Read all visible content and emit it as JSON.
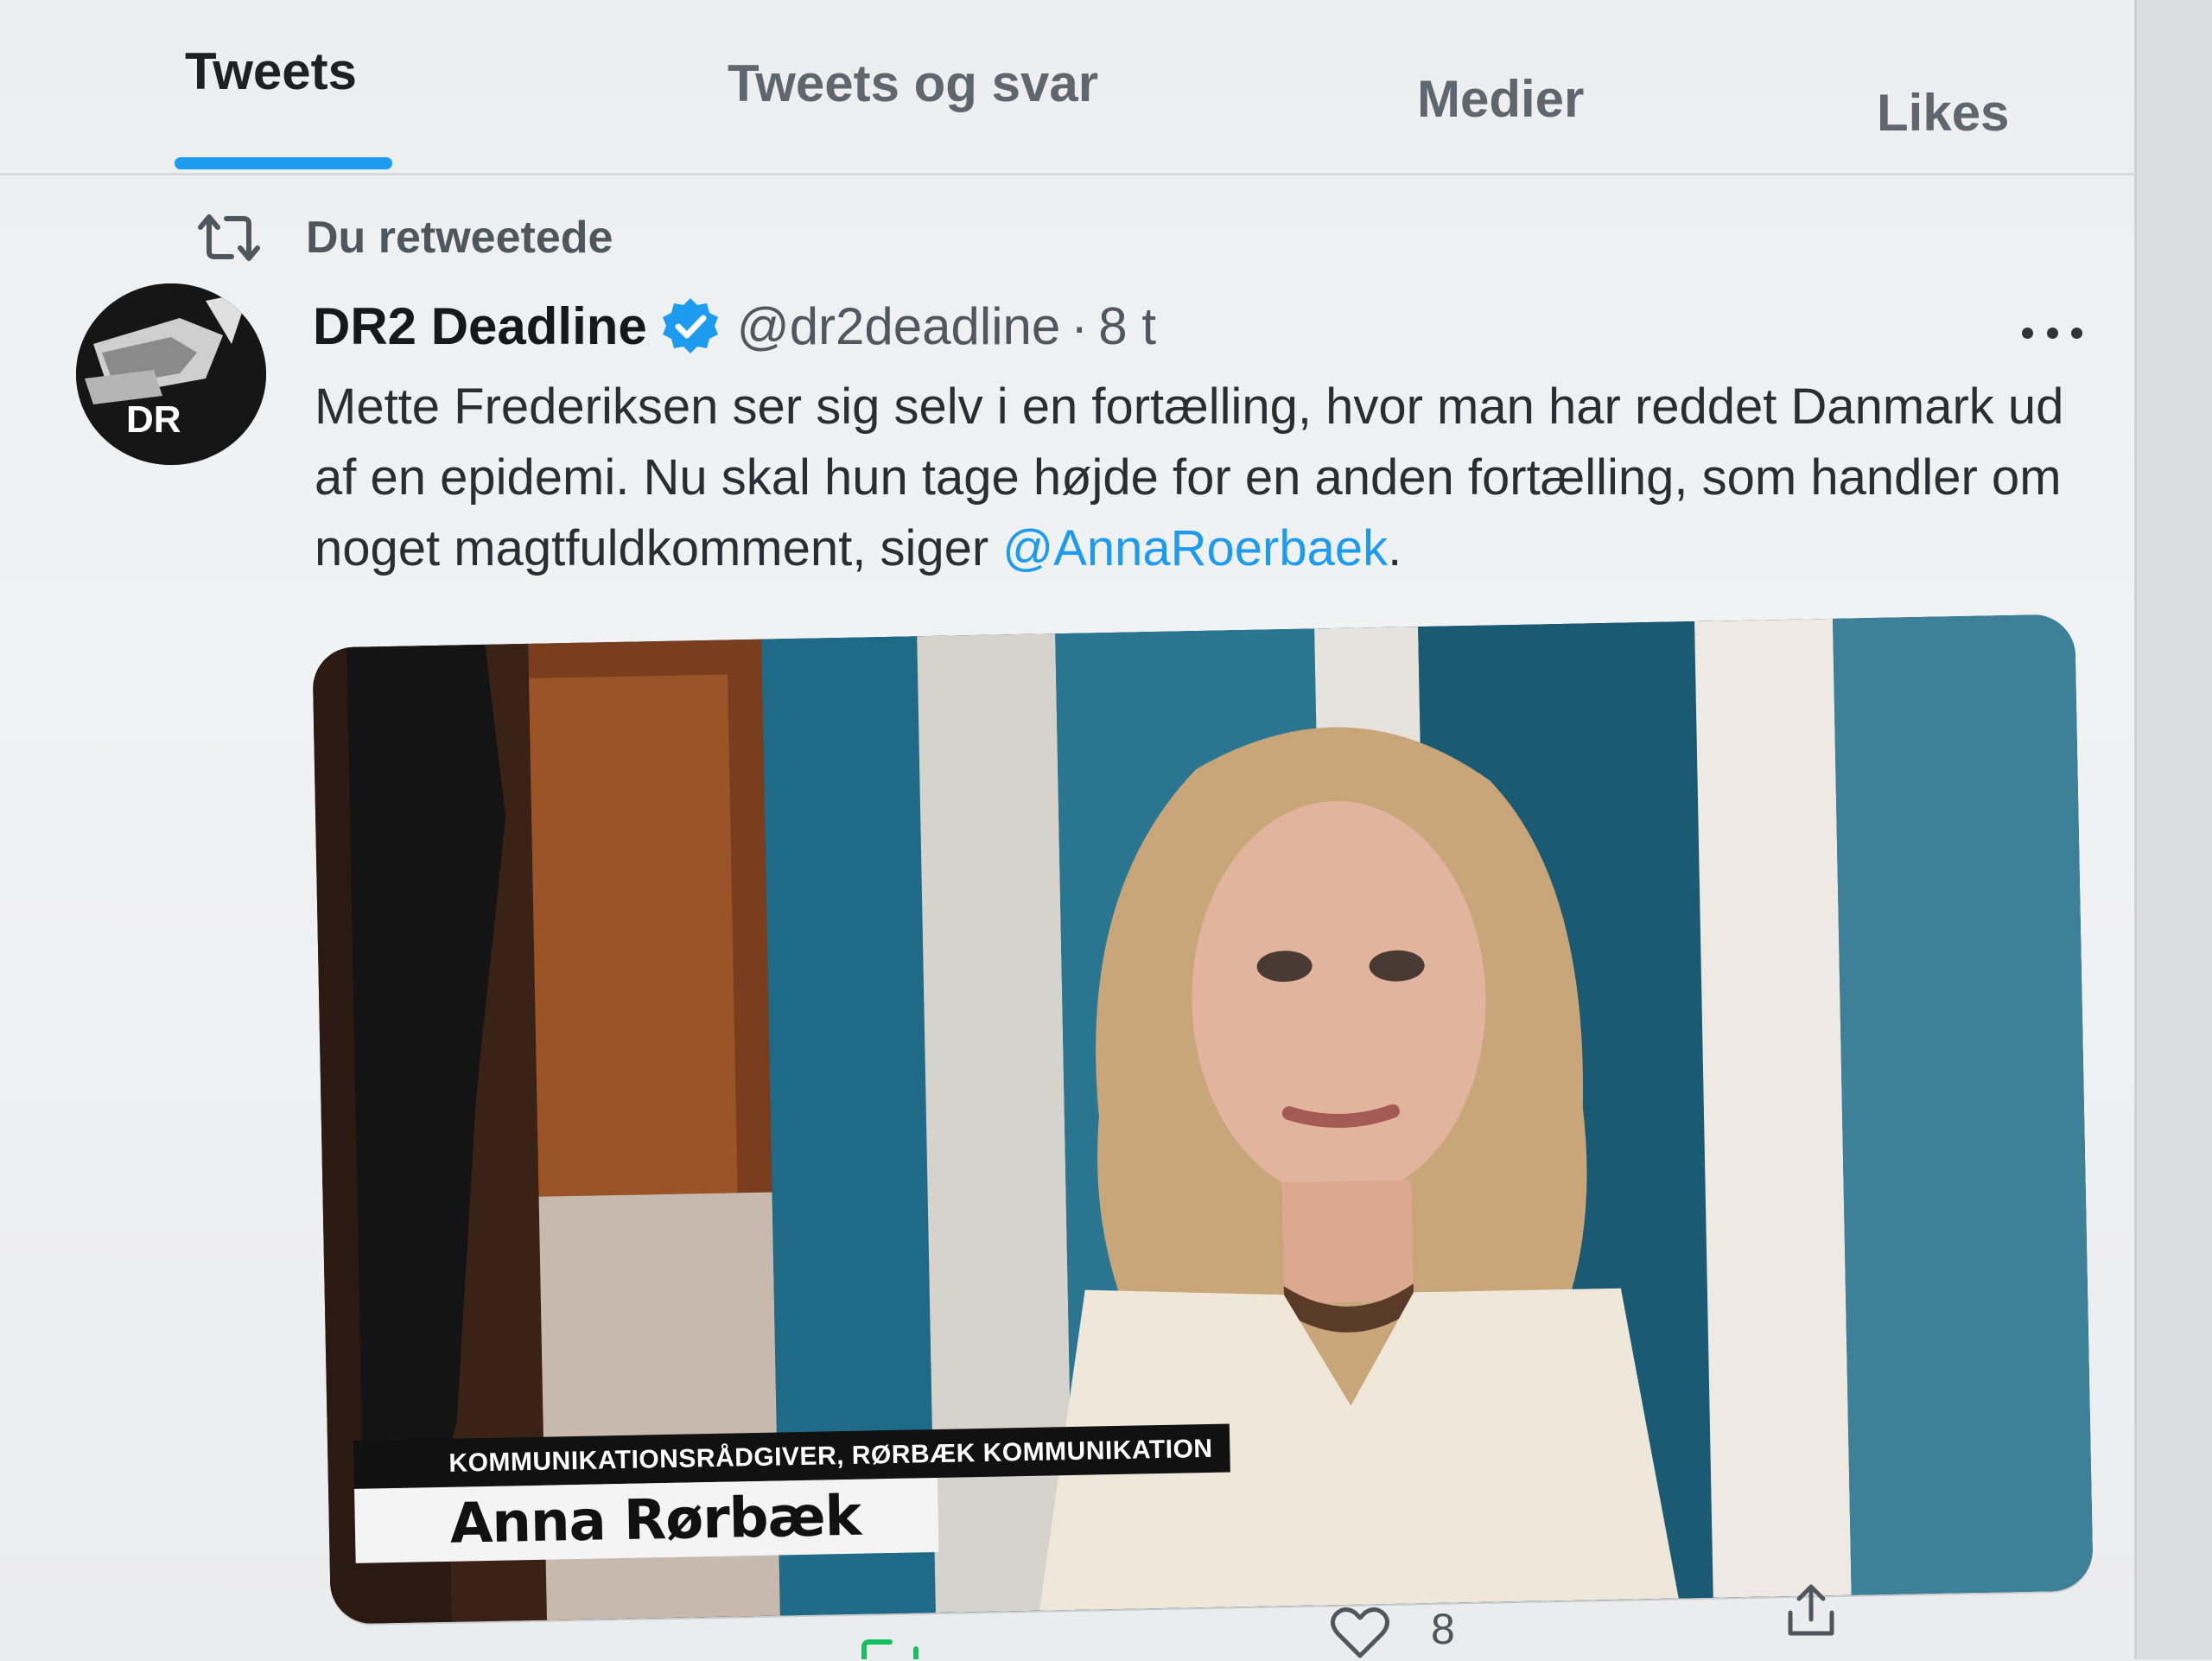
{
  "tabs": [
    {
      "label": "Tweets",
      "active": true
    },
    {
      "label": "Tweets og svar",
      "active": false
    },
    {
      "label": "Medier",
      "active": false
    },
    {
      "label": "Likes",
      "active": false
    }
  ],
  "accent_color": "#1d9bf0",
  "retweet_context": {
    "icon": "retweet-icon",
    "text": "Du retweetede"
  },
  "tweet": {
    "author_name": "DR2 Deadline",
    "verified": true,
    "verified_icon": "verified-badge-icon",
    "handle": "@dr2deadline",
    "separator": "·",
    "time": "8 t",
    "avatar_text": "DR",
    "text_before_mention": "Mette Frederiksen ser sig selv i en fortælling, hvor man har reddet Danmark ud af en epidemi. Nu skal hun tage højde for en anden fortælling, som handler om noget magtfuldkomment, siger ",
    "mention": "@AnnaRoerbaek",
    "text_after_mention": ".",
    "media": {
      "lower_third_role": "KOMMUNIKATIONSRÅDGIVER, RØRBÆK KOMMUNIKATION",
      "lower_third_name": "Anna Rørbæk"
    },
    "actions": {
      "like_count": "8",
      "like_icon": "heart-icon",
      "share_icon": "share-icon",
      "retweet_icon": "retweet-icon"
    }
  }
}
